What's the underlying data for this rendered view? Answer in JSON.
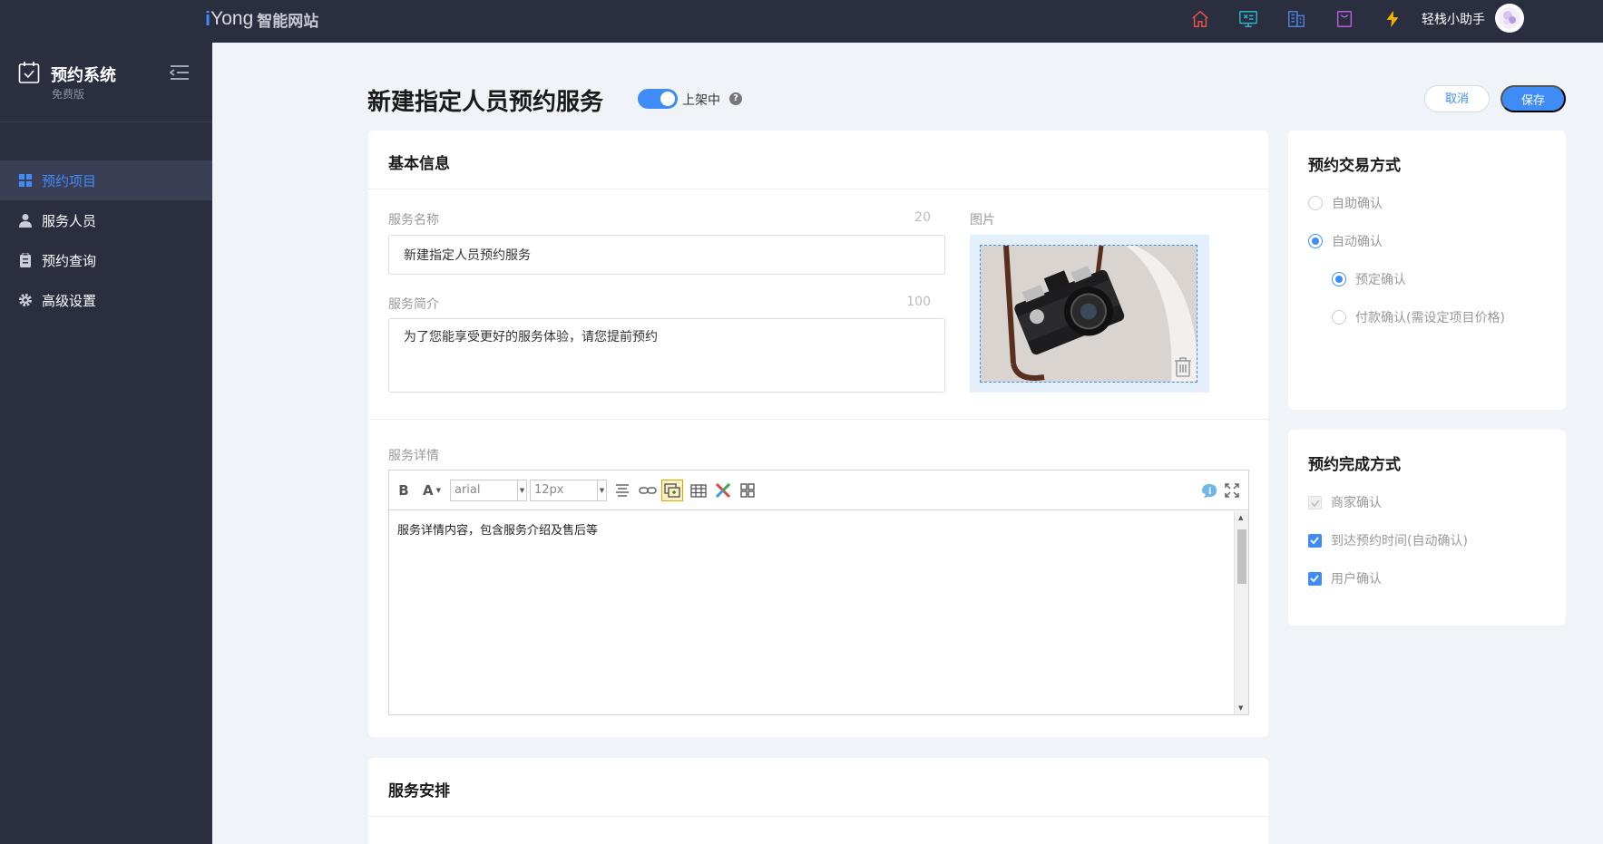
{
  "topbar": {
    "logo_i": "i",
    "logo_brand": "Yong",
    "logo_cn": "智能网站",
    "icons": [
      "home-icon",
      "monitor-icon",
      "building-icon",
      "bag-icon",
      "lightning-icon"
    ],
    "assistant_label": "轻栈小助手"
  },
  "sidebar": {
    "system_title": "预约系统",
    "system_edition": "免费版",
    "items": [
      {
        "label": "预约项目",
        "icon": "grid-icon",
        "active": true
      },
      {
        "label": "服务人员",
        "icon": "user-icon",
        "active": false
      },
      {
        "label": "预约查询",
        "icon": "clipboard-icon",
        "active": false
      },
      {
        "label": "高级设置",
        "icon": "gear-icon",
        "active": false
      }
    ]
  },
  "header": {
    "title": "新建指定人员预约服务",
    "status_label": "上架中",
    "status_on": true,
    "help": "?",
    "cancel_label": "取消",
    "save_label": "保存"
  },
  "basic": {
    "title": "基本信息",
    "name_label": "服务名称",
    "name_limit": "20",
    "name_value": "新建指定人员预约服务",
    "intro_label": "服务简介",
    "intro_limit": "100",
    "intro_value": "为了您能享受更好的服务体验，请您提前预约",
    "image_label": "图片",
    "detail_label": "服务详情",
    "editor": {
      "bold": "B",
      "font_color": "A",
      "font_family": "arial",
      "font_size": "12px",
      "content": "服务详情内容，包含服务介绍及售后等"
    }
  },
  "schedule": {
    "title": "服务安排"
  },
  "transaction": {
    "title": "预约交易方式",
    "options": [
      {
        "label": "自助确认",
        "selected": false
      },
      {
        "label": "自动确认",
        "selected": true
      },
      {
        "label": "预定确认",
        "selected": true
      },
      {
        "label": "付款确认(需设定项目价格)",
        "selected": false
      }
    ]
  },
  "completion": {
    "title": "预约完成方式",
    "options": [
      {
        "label": "商家确认",
        "checked": true,
        "disabled": true
      },
      {
        "label": "到达预约时间(自动确认)",
        "checked": true,
        "disabled": false
      },
      {
        "label": "用户确认",
        "checked": true,
        "disabled": false
      }
    ]
  },
  "colors": {
    "accent": "#3f8cf7",
    "sidebar_bg": "#2a2e3f",
    "page_bg": "#f0f3f7"
  }
}
